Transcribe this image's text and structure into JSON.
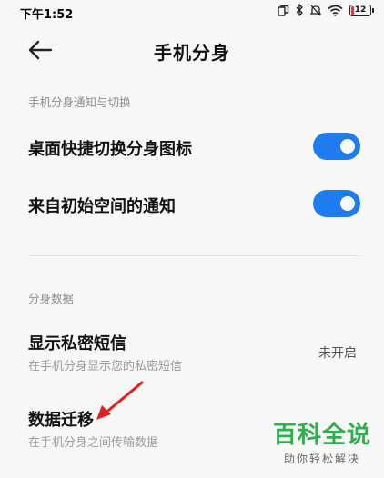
{
  "status_bar": {
    "time": "下午1:52",
    "battery_text": "12",
    "battery_level": 0.12,
    "icons": [
      "dual-screen-icon",
      "bluetooth-icon",
      "mute-icon",
      "wifi-icon",
      "battery-icon"
    ]
  },
  "header": {
    "title": "手机分身",
    "back_icon": "back-arrow-icon"
  },
  "sections": [
    {
      "header": "手机分身通知与切换",
      "items": [
        {
          "label": "桌面快捷切换分身图标",
          "toggle_on": true
        },
        {
          "label": "来自初始空间的通知",
          "toggle_on": true
        }
      ]
    },
    {
      "header": "分身数据",
      "items": [
        {
          "label": "显示私密短信",
          "subtitle": "在手机分身显示您的私密短信",
          "value": "未开启"
        },
        {
          "label": "数据迁移",
          "subtitle": "在手机分身之间传输数据"
        }
      ]
    }
  ],
  "watermark": {
    "title": "百科全说",
    "subtitle": "助你轻松解决"
  },
  "colors": {
    "accent": "#1e7bf0",
    "watermark_green": "#2fae4f",
    "annotation_red": "#e41e1e"
  }
}
